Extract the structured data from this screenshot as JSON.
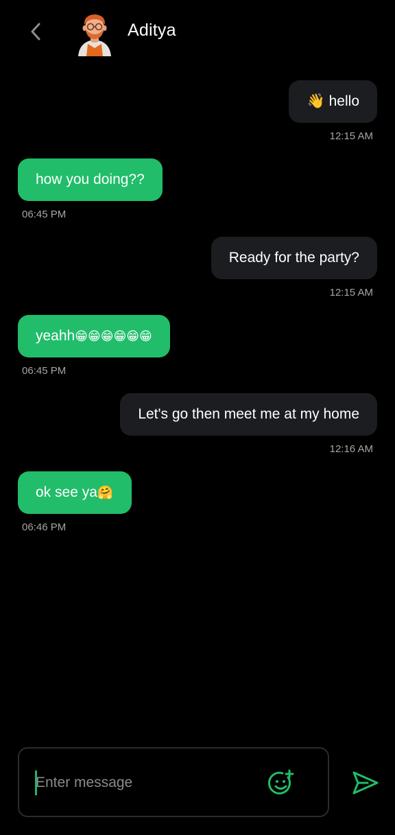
{
  "header": {
    "contact_name": "Aditya"
  },
  "messages": [
    {
      "direction": "out",
      "emoji_prefix": "👋",
      "text": "hello",
      "time": "12:15 AM"
    },
    {
      "direction": "in",
      "text": "how you doing??",
      "time": "06:45 PM"
    },
    {
      "direction": "out",
      "text": "Ready for the party?",
      "time": "12:15 AM"
    },
    {
      "direction": "in",
      "text": "yeahh",
      "emoji_suffix": "😁😁😁😁😁😁",
      "time": "06:45 PM"
    },
    {
      "direction": "out",
      "text": "Let's go then meet me at my home",
      "time": "12:16 AM"
    },
    {
      "direction": "in",
      "text": "ok see ya",
      "emoji_suffix": "🤗",
      "time": "06:46 PM"
    }
  ],
  "composer": {
    "placeholder": "Enter message",
    "value": ""
  },
  "icons": {
    "back": "chevron-left-icon",
    "emoji": "emoji-add-icon",
    "send": "send-icon"
  },
  "colors": {
    "background": "#000000",
    "incoming_bubble": "#21bd6a",
    "outgoing_bubble": "#1b1d21",
    "accent": "#21bd6a",
    "timestamp": "#a6a6a6"
  }
}
